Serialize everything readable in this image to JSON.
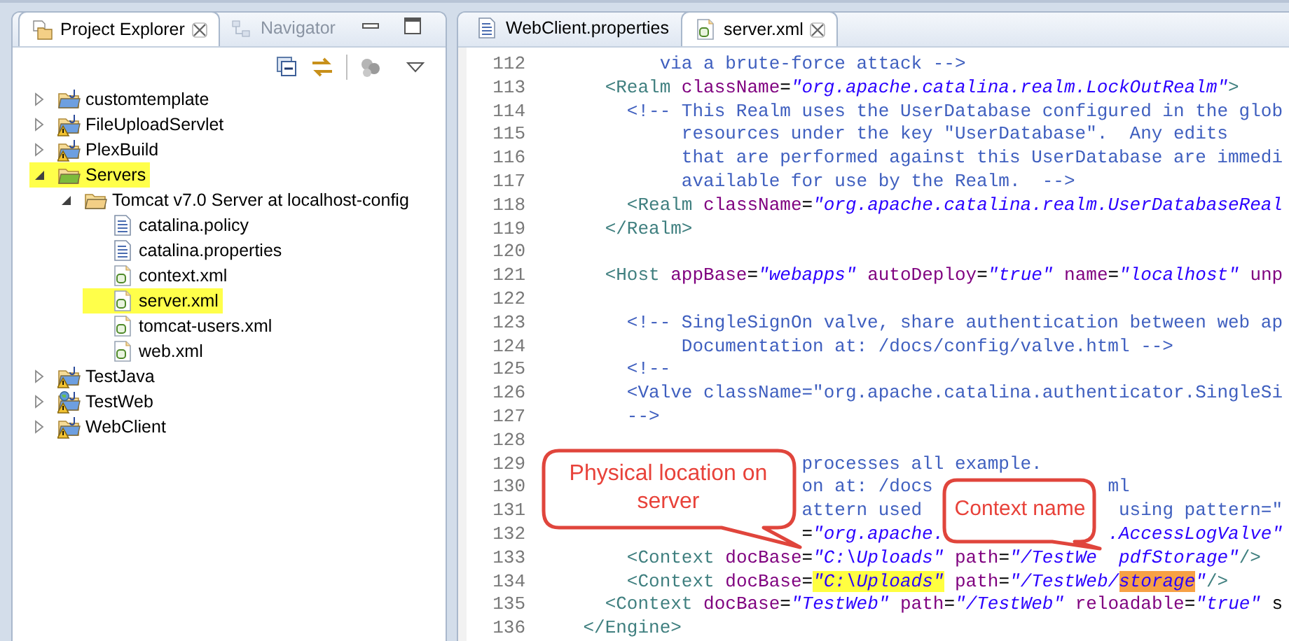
{
  "explorer": {
    "tabs": [
      {
        "label": "Project Explorer",
        "kind": "explorer",
        "selected": true,
        "closable": true
      },
      {
        "label": "Navigator",
        "kind": "navigator",
        "selected": false,
        "closable": false
      }
    ],
    "tree": [
      {
        "label": "customtemplate",
        "kind": "project",
        "warning": false,
        "expanded": false,
        "highlighted": false
      },
      {
        "label": "FileUploadServlet",
        "kind": "project",
        "warning": true,
        "expanded": false,
        "highlighted": false
      },
      {
        "label": "PlexBuild",
        "kind": "project",
        "warning": true,
        "expanded": false,
        "highlighted": false
      },
      {
        "label": "Servers",
        "kind": "server-folder",
        "warning": false,
        "expanded": true,
        "highlighted": true,
        "children": [
          {
            "label": "Tomcat v7.0 Server at localhost-config",
            "kind": "folder",
            "warning": false,
            "expanded": true,
            "highlighted": false,
            "children": [
              {
                "label": "catalina.policy",
                "kind": "text-file",
                "warning": false,
                "highlighted": false
              },
              {
                "label": "catalina.properties",
                "kind": "text-file",
                "warning": false,
                "highlighted": false
              },
              {
                "label": "context.xml",
                "kind": "xml",
                "warning": false,
                "highlighted": false
              },
              {
                "label": "server.xml",
                "kind": "xml",
                "warning": false,
                "highlighted": true
              },
              {
                "label": "tomcat-users.xml",
                "kind": "xml",
                "warning": false,
                "highlighted": false
              },
              {
                "label": "web.xml",
                "kind": "xml",
                "warning": false,
                "highlighted": false
              }
            ]
          }
        ]
      },
      {
        "label": "TestJava",
        "kind": "project",
        "warning": true,
        "expanded": false,
        "highlighted": false
      },
      {
        "label": "TestWeb",
        "kind": "web-project",
        "warning": true,
        "expanded": false,
        "highlighted": false
      },
      {
        "label": "WebClient",
        "kind": "project",
        "warning": true,
        "expanded": false,
        "highlighted": false
      }
    ]
  },
  "editor": {
    "tabs": [
      {
        "label": "WebClient.properties",
        "kind": "text-file",
        "selected": false,
        "closable": false
      },
      {
        "label": "server.xml",
        "kind": "xml",
        "selected": true,
        "closable": true
      }
    ],
    "lines": [
      {
        "number": "112",
        "tokens": [
          {
            "kind": "comment",
            "text": "           via a brute-force attack -->"
          }
        ]
      },
      {
        "number": "113",
        "tokens": [
          {
            "kind": "tag",
            "text": "      <Realm"
          },
          {
            "kind": "attr",
            "text": " className"
          },
          {
            "kind": "text",
            "text": "="
          },
          {
            "kind": "value",
            "text": "\"org.apache.catalina.realm.LockOutRealm\""
          },
          {
            "kind": "tag",
            "text": ">"
          }
        ]
      },
      {
        "number": "114",
        "tokens": [
          {
            "kind": "comment",
            "text": "        <!-- This Realm uses the UserDatabase configured in the glob"
          }
        ]
      },
      {
        "number": "115",
        "tokens": [
          {
            "kind": "comment",
            "text": "             resources under the key \"UserDatabase\".  Any edits"
          }
        ]
      },
      {
        "number": "116",
        "tokens": [
          {
            "kind": "comment",
            "text": "             that are performed against this UserDatabase are immedi"
          }
        ]
      },
      {
        "number": "117",
        "tokens": [
          {
            "kind": "comment",
            "text": "             available for use by the Realm.  -->"
          }
        ]
      },
      {
        "number": "118",
        "tokens": [
          {
            "kind": "tag",
            "text": "        <Realm"
          },
          {
            "kind": "attr",
            "text": " className"
          },
          {
            "kind": "text",
            "text": "="
          },
          {
            "kind": "value",
            "text": "\"org.apache.catalina.realm.UserDatabaseReal"
          }
        ]
      },
      {
        "number": "119",
        "tokens": [
          {
            "kind": "tag",
            "text": "      </Realm>"
          }
        ]
      },
      {
        "number": "120"
      },
      {
        "number": "121",
        "tokens": [
          {
            "kind": "tag",
            "text": "      <Host"
          },
          {
            "kind": "attr",
            "text": " appBase"
          },
          {
            "kind": "text",
            "text": "="
          },
          {
            "kind": "value",
            "text": "\"webapps\""
          },
          {
            "kind": "attr",
            "text": " autoDeploy"
          },
          {
            "kind": "text",
            "text": "="
          },
          {
            "kind": "value",
            "text": "\"true\""
          },
          {
            "kind": "attr",
            "text": " name"
          },
          {
            "kind": "text",
            "text": "="
          },
          {
            "kind": "value",
            "text": "\"localhost\""
          },
          {
            "kind": "attr",
            "text": " unp"
          }
        ]
      },
      {
        "number": "122"
      },
      {
        "number": "123",
        "tokens": [
          {
            "kind": "comment",
            "text": "        <!-- SingleSignOn valve, share authentication between web ap"
          }
        ]
      },
      {
        "number": "124",
        "tokens": [
          {
            "kind": "comment",
            "text": "             Documentation at: /docs/config/valve.html -->"
          }
        ]
      },
      {
        "number": "125",
        "tokens": [
          {
            "kind": "comment",
            "text": "        <!--"
          }
        ]
      },
      {
        "number": "126",
        "tokens": [
          {
            "kind": "comment",
            "text": "        <Valve className=\"org.apache.catalina.authenticator.SingleSi"
          }
        ]
      },
      {
        "number": "127",
        "tokens": [
          {
            "kind": "comment",
            "text": "        -->"
          }
        ]
      },
      {
        "number": "128"
      },
      {
        "number": "129",
        "tokens": [
          {
            "kind": "comment",
            "text": "                        processes all example."
          }
        ]
      },
      {
        "number": "130",
        "tokens": [
          {
            "kind": "comment",
            "text": "                        on at: /docs                ml"
          }
        ]
      },
      {
        "number": "131",
        "tokens": [
          {
            "kind": "comment",
            "text": "                        attern used                  using pattern=\""
          }
        ]
      },
      {
        "number": "132",
        "tokens": [
          {
            "kind": "text",
            "text": "                        ="
          },
          {
            "kind": "value",
            "text": "\"org.apache.               .AccessLogValve\""
          }
        ]
      },
      {
        "number": "133",
        "tokens": [
          {
            "kind": "tag",
            "text": "        <Context"
          },
          {
            "kind": "attr",
            "text": " docBase"
          },
          {
            "kind": "text",
            "text": "="
          },
          {
            "kind": "value",
            "text": "\"C:\\Uploads\""
          },
          {
            "kind": "attr",
            "text": " path"
          },
          {
            "kind": "text",
            "text": "="
          },
          {
            "kind": "value",
            "text": "\"/TestWe  pdfStorage\""
          },
          {
            "kind": "tag",
            "text": "/>"
          }
        ]
      },
      {
        "number": "134",
        "tokens": [
          {
            "kind": "tag",
            "text": "        <Context"
          },
          {
            "kind": "attr",
            "text": " docBase"
          },
          {
            "kind": "text",
            "text": "="
          },
          {
            "kind": "value",
            "text": "\"C:\\Uploads\"",
            "color": "#ffff40"
          },
          {
            "kind": "attr",
            "text": " path"
          },
          {
            "kind": "text",
            "text": "="
          },
          {
            "kind": "value",
            "text": "\"/TestWeb/"
          },
          {
            "kind": "value",
            "text": "storage",
            "color": "#f7a145"
          },
          {
            "kind": "value",
            "text": "\""
          },
          {
            "kind": "tag",
            "text": "/>"
          }
        ]
      },
      {
        "number": "135",
        "tokens": [
          {
            "kind": "tag",
            "text": "      <Context"
          },
          {
            "kind": "attr",
            "text": " docBase"
          },
          {
            "kind": "text",
            "text": "="
          },
          {
            "kind": "value",
            "text": "\"TestWeb\""
          },
          {
            "kind": "attr",
            "text": " path"
          },
          {
            "kind": "text",
            "text": "="
          },
          {
            "kind": "value",
            "text": "\"/TestWeb\""
          },
          {
            "kind": "attr",
            "text": " reloadable"
          },
          {
            "kind": "text",
            "text": "="
          },
          {
            "kind": "value",
            "text": "\"true\""
          },
          {
            "kind": "text",
            "text": " s"
          }
        ]
      },
      {
        "number": "136",
        "tokens": [
          {
            "kind": "tag",
            "text": "    </Engine>"
          }
        ]
      }
    ]
  },
  "callouts": [
    {
      "text": "Physical location on server"
    },
    {
      "text": "Context name"
    }
  ]
}
